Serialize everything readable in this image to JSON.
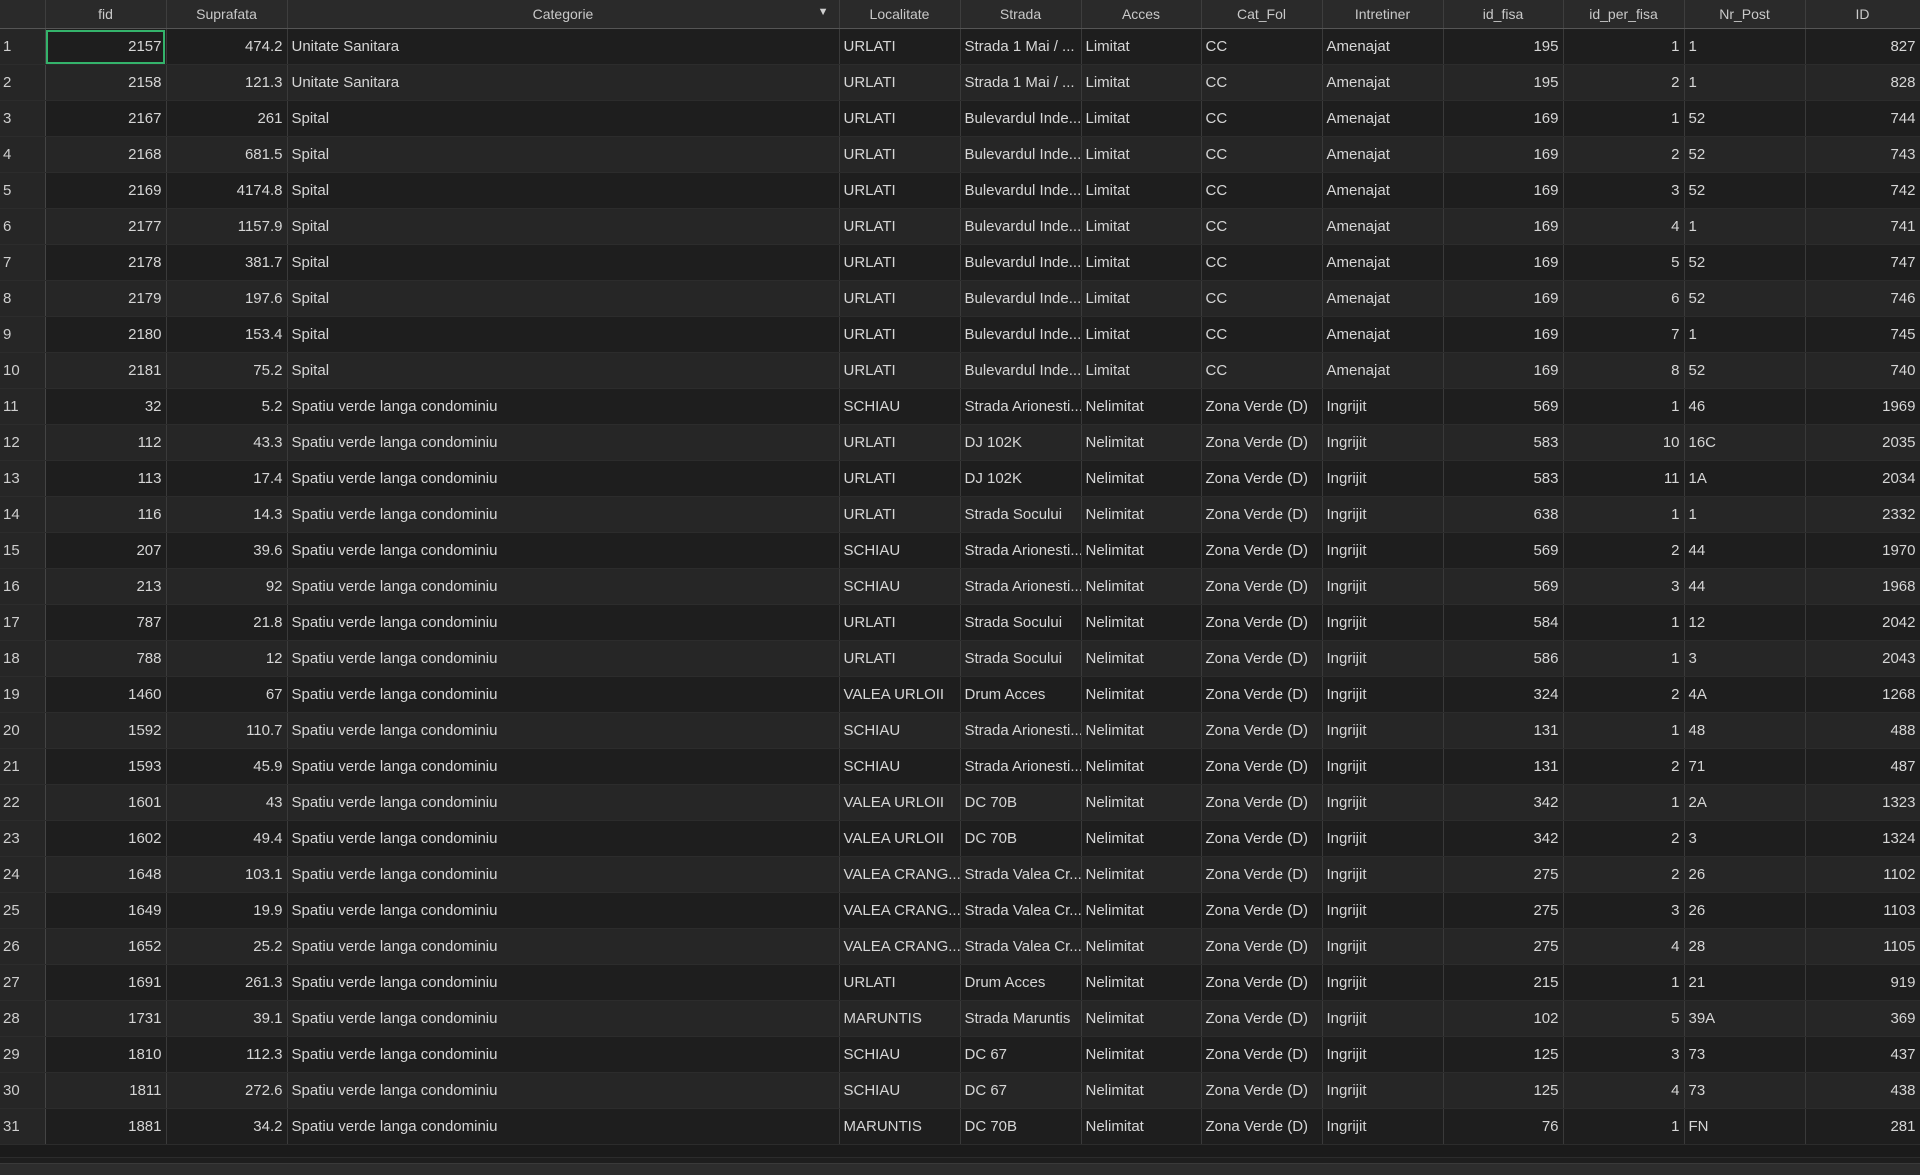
{
  "table": {
    "columns": [
      {
        "label": "fid",
        "align": "num"
      },
      {
        "label": "Suprafata",
        "align": "num"
      },
      {
        "label": "Categorie",
        "align": "txt",
        "sorted": true
      },
      {
        "label": "Localitate",
        "align": "txt"
      },
      {
        "label": "Strada",
        "align": "txt"
      },
      {
        "label": "Acces",
        "align": "txt"
      },
      {
        "label": "Cat_Fol",
        "align": "txt"
      },
      {
        "label": "Intretiner",
        "align": "txt"
      },
      {
        "label": "id_fisa",
        "align": "num"
      },
      {
        "label": "id_per_fisa",
        "align": "num"
      },
      {
        "label": "Nr_Post",
        "align": "txt"
      },
      {
        "label": "ID",
        "align": "num"
      }
    ],
    "sort_indicator": "▼",
    "selected_cell": {
      "row": 1,
      "column": "fid"
    },
    "rows": [
      [
        "1",
        "2157",
        "474.2",
        "Unitate Sanitara",
        "URLATI",
        "Strada 1 Mai / ...",
        "Limitat",
        "CC",
        "Amenajat",
        "195",
        "1",
        "1",
        "827"
      ],
      [
        "2",
        "2158",
        "121.3",
        "Unitate Sanitara",
        "URLATI",
        "Strada 1 Mai / ...",
        "Limitat",
        "CC",
        "Amenajat",
        "195",
        "2",
        "1",
        "828"
      ],
      [
        "3",
        "2167",
        "261",
        "Spital",
        "URLATI",
        "Bulevardul Inde...",
        "Limitat",
        "CC",
        "Amenajat",
        "169",
        "1",
        "52",
        "744"
      ],
      [
        "4",
        "2168",
        "681.5",
        "Spital",
        "URLATI",
        "Bulevardul Inde...",
        "Limitat",
        "CC",
        "Amenajat",
        "169",
        "2",
        "52",
        "743"
      ],
      [
        "5",
        "2169",
        "4174.8",
        "Spital",
        "URLATI",
        "Bulevardul Inde...",
        "Limitat",
        "CC",
        "Amenajat",
        "169",
        "3",
        "52",
        "742"
      ],
      [
        "6",
        "2177",
        "1157.9",
        "Spital",
        "URLATI",
        "Bulevardul Inde...",
        "Limitat",
        "CC",
        "Amenajat",
        "169",
        "4",
        "1",
        "741"
      ],
      [
        "7",
        "2178",
        "381.7",
        "Spital",
        "URLATI",
        "Bulevardul Inde...",
        "Limitat",
        "CC",
        "Amenajat",
        "169",
        "5",
        "52",
        "747"
      ],
      [
        "8",
        "2179",
        "197.6",
        "Spital",
        "URLATI",
        "Bulevardul Inde...",
        "Limitat",
        "CC",
        "Amenajat",
        "169",
        "6",
        "52",
        "746"
      ],
      [
        "9",
        "2180",
        "153.4",
        "Spital",
        "URLATI",
        "Bulevardul Inde...",
        "Limitat",
        "CC",
        "Amenajat",
        "169",
        "7",
        "1",
        "745"
      ],
      [
        "10",
        "2181",
        "75.2",
        "Spital",
        "URLATI",
        "Bulevardul Inde...",
        "Limitat",
        "CC",
        "Amenajat",
        "169",
        "8",
        "52",
        "740"
      ],
      [
        "11",
        "32",
        "5.2",
        "Spatiu verde langa condominiu",
        "SCHIAU",
        "Strada Arionesti...",
        "Nelimitat",
        "Zona Verde (D)",
        "Ingrijit",
        "569",
        "1",
        "46",
        "1969"
      ],
      [
        "12",
        "112",
        "43.3",
        "Spatiu verde langa condominiu",
        "URLATI",
        "DJ 102K",
        "Nelimitat",
        "Zona Verde (D)",
        "Ingrijit",
        "583",
        "10",
        "16C",
        "2035"
      ],
      [
        "13",
        "113",
        "17.4",
        "Spatiu verde langa condominiu",
        "URLATI",
        "DJ 102K",
        "Nelimitat",
        "Zona Verde (D)",
        "Ingrijit",
        "583",
        "11",
        "1A",
        "2034"
      ],
      [
        "14",
        "116",
        "14.3",
        "Spatiu verde langa condominiu",
        "URLATI",
        "Strada Socului",
        "Nelimitat",
        "Zona Verde (D)",
        "Ingrijit",
        "638",
        "1",
        "1",
        "2332"
      ],
      [
        "15",
        "207",
        "39.6",
        "Spatiu verde langa condominiu",
        "SCHIAU",
        "Strada Arionesti...",
        "Nelimitat",
        "Zona Verde (D)",
        "Ingrijit",
        "569",
        "2",
        "44",
        "1970"
      ],
      [
        "16",
        "213",
        "92",
        "Spatiu verde langa condominiu",
        "SCHIAU",
        "Strada Arionesti...",
        "Nelimitat",
        "Zona Verde (D)",
        "Ingrijit",
        "569",
        "3",
        "44",
        "1968"
      ],
      [
        "17",
        "787",
        "21.8",
        "Spatiu verde langa condominiu",
        "URLATI",
        "Strada Socului",
        "Nelimitat",
        "Zona Verde (D)",
        "Ingrijit",
        "584",
        "1",
        "12",
        "2042"
      ],
      [
        "18",
        "788",
        "12",
        "Spatiu verde langa condominiu",
        "URLATI",
        "Strada Socului",
        "Nelimitat",
        "Zona Verde (D)",
        "Ingrijit",
        "586",
        "1",
        "3",
        "2043"
      ],
      [
        "19",
        "1460",
        "67",
        "Spatiu verde langa condominiu",
        "VALEA URLOII",
        "Drum Acces",
        "Nelimitat",
        "Zona Verde (D)",
        "Ingrijit",
        "324",
        "2",
        "4A",
        "1268"
      ],
      [
        "20",
        "1592",
        "110.7",
        "Spatiu verde langa condominiu",
        "SCHIAU",
        "Strada Arionesti...",
        "Nelimitat",
        "Zona Verde (D)",
        "Ingrijit",
        "131",
        "1",
        "48",
        "488"
      ],
      [
        "21",
        "1593",
        "45.9",
        "Spatiu verde langa condominiu",
        "SCHIAU",
        "Strada Arionesti...",
        "Nelimitat",
        "Zona Verde (D)",
        "Ingrijit",
        "131",
        "2",
        "71",
        "487"
      ],
      [
        "22",
        "1601",
        "43",
        "Spatiu verde langa condominiu",
        "VALEA URLOII",
        "DC 70B",
        "Nelimitat",
        "Zona Verde (D)",
        "Ingrijit",
        "342",
        "1",
        "2A",
        "1323"
      ],
      [
        "23",
        "1602",
        "49.4",
        "Spatiu verde langa condominiu",
        "VALEA URLOII",
        "DC 70B",
        "Nelimitat",
        "Zona Verde (D)",
        "Ingrijit",
        "342",
        "2",
        "3",
        "1324"
      ],
      [
        "24",
        "1648",
        "103.1",
        "Spatiu verde langa condominiu",
        "VALEA CRANG...",
        "Strada Valea Cr...",
        "Nelimitat",
        "Zona Verde (D)",
        "Ingrijit",
        "275",
        "2",
        "26",
        "1102"
      ],
      [
        "25",
        "1649",
        "19.9",
        "Spatiu verde langa condominiu",
        "VALEA CRANG...",
        "Strada Valea Cr...",
        "Nelimitat",
        "Zona Verde (D)",
        "Ingrijit",
        "275",
        "3",
        "26",
        "1103"
      ],
      [
        "26",
        "1652",
        "25.2",
        "Spatiu verde langa condominiu",
        "VALEA CRANG...",
        "Strada Valea Cr...",
        "Nelimitat",
        "Zona Verde (D)",
        "Ingrijit",
        "275",
        "4",
        "28",
        "1105"
      ],
      [
        "27",
        "1691",
        "261.3",
        "Spatiu verde langa condominiu",
        "URLATI",
        "Drum Acces",
        "Nelimitat",
        "Zona Verde (D)",
        "Ingrijit",
        "215",
        "1",
        "21",
        "919"
      ],
      [
        "28",
        "1731",
        "39.1",
        "Spatiu verde langa condominiu",
        "MARUNTIS",
        "Strada Maruntis",
        "Nelimitat",
        "Zona Verde (D)",
        "Ingrijit",
        "102",
        "5",
        "39A",
        "369"
      ],
      [
        "29",
        "1810",
        "112.3",
        "Spatiu verde langa condominiu",
        "SCHIAU",
        "DC 67",
        "Nelimitat",
        "Zona Verde (D)",
        "Ingrijit",
        "125",
        "3",
        "73",
        "437"
      ],
      [
        "30",
        "1811",
        "272.6",
        "Spatiu verde langa condominiu",
        "SCHIAU",
        "DC 67",
        "Nelimitat",
        "Zona Verde (D)",
        "Ingrijit",
        "125",
        "4",
        "73",
        "438"
      ],
      [
        "31",
        "1881",
        "34.2",
        "Spatiu verde langa condominiu",
        "MARUNTIS",
        "DC 70B",
        "Nelimitat",
        "Zona Verde (D)",
        "Ingrijit",
        "76",
        "1",
        "FN",
        "281"
      ]
    ]
  },
  "colors": {
    "background": "#1b1b1b",
    "row_even": "#262626",
    "row_odd": "#1e1e1e",
    "selection_outline": "#34b36b",
    "text": "#d6d6d6"
  }
}
